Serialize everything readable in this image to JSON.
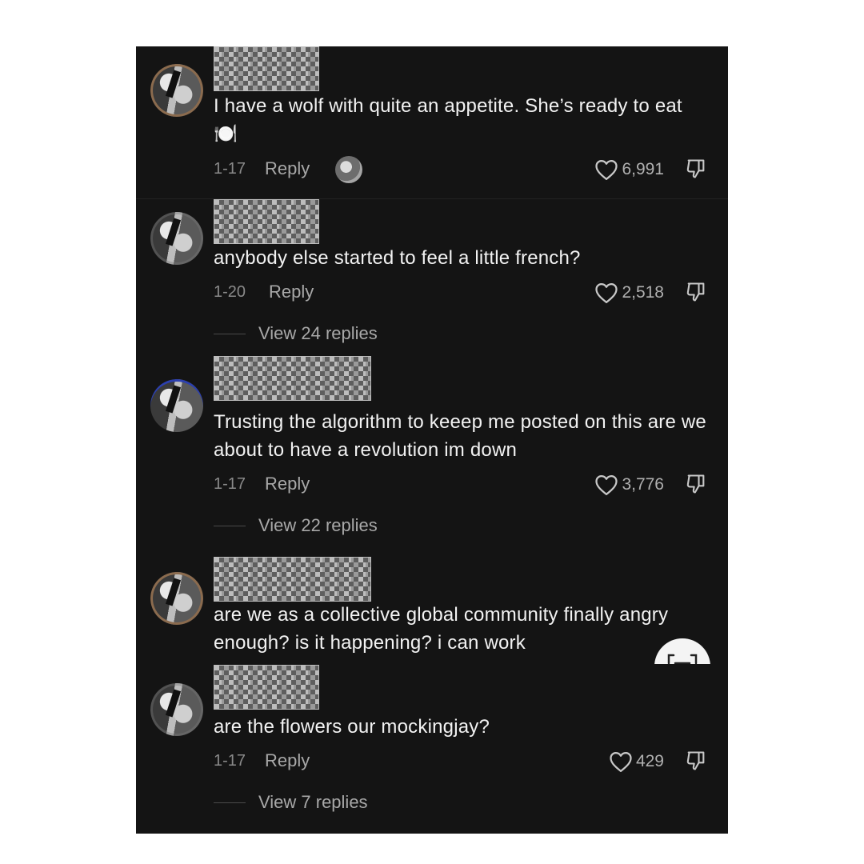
{
  "comments": [
    {
      "text": "I have a wolf with quite an appetite. She’s ready to eat 🍽️",
      "date": "1-17",
      "reply_label": "Reply",
      "likes": "6,991"
    },
    {
      "text": "anybody else started to feel a little french?",
      "date": "1-20",
      "reply_label": "Reply",
      "likes": "2,518",
      "view_replies": "View 24 replies"
    },
    {
      "text": "Trusting the algorithm to keeep me posted on this are we about to have a revolution im down",
      "date": "1-17",
      "reply_label": "Reply",
      "likes": "3,776",
      "view_replies": "View 22 replies"
    },
    {
      "text": "are we as a collective global community finally angry enough? is it happening? i can work"
    },
    {
      "text": "are the flowers our mockingjay?",
      "date": "1-17",
      "reply_label": "Reply",
      "likes": "429",
      "view_replies": "View 7 replies"
    }
  ],
  "icons": {
    "like": "heart-icon",
    "dislike": "thumbs-down-icon",
    "floating": "minimize-icon"
  },
  "colors": {
    "panel_bg": "#141414",
    "text": "#f2f2f2",
    "muted": "#9a9a9a"
  }
}
